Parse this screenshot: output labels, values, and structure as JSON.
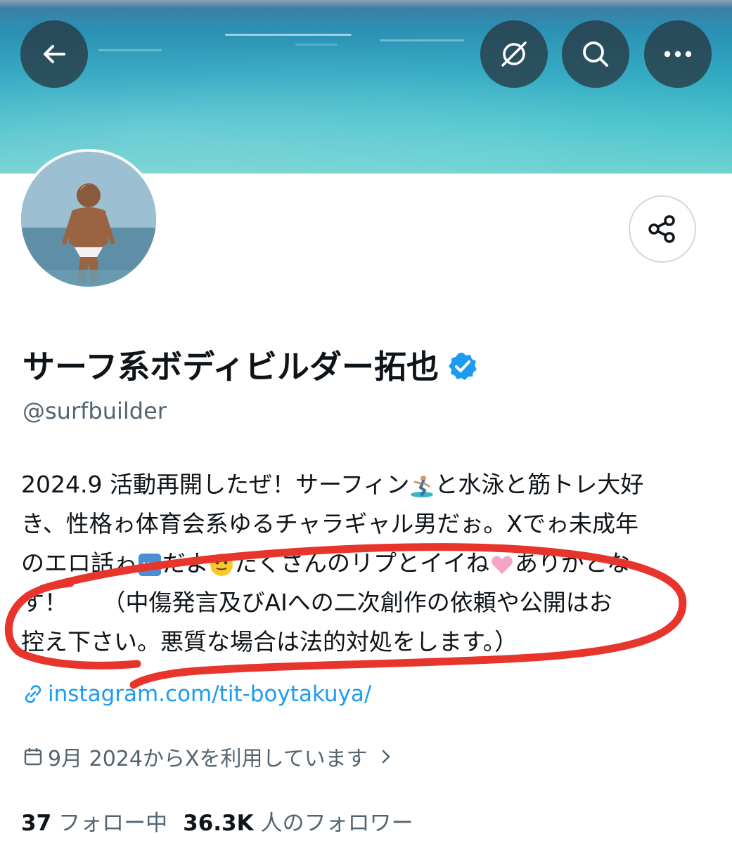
{
  "header": {
    "back_icon": "arrow-left-icon",
    "buttons": [
      {
        "icon": "no-notifications-icon"
      },
      {
        "icon": "search-icon"
      },
      {
        "icon": "more-horizontal-icon"
      }
    ]
  },
  "profile": {
    "display_name": "サーフ系ボディビルダー拓也",
    "verified": true,
    "verified_color": "#1d9bf0",
    "handle": "@surfbuilder",
    "bio_lines": [
      {
        "a": "2024.9 活動再開したぜ！サーフィン",
        "emoji": "surfer-emoji",
        "b": "と水泳と筋トレ大好"
      },
      {
        "a": "き、性格ゎ体育会系ゆるチャラギャル男だぉ。Xでゎ未成年",
        "emoji": "",
        "b": ""
      },
      {
        "a": "のエロ話ゎ",
        "emoji": "ng-button-emoji",
        "b": "だよ",
        "emoji2": "smiley-emoji",
        "c": "たくさんのリプとイイね",
        "emoji3": "pink-heart-emoji",
        "d": "ありがとな"
      },
      {
        "a": "す！　　（中傷発言及びAIへの二次創作の依頼や公開はお",
        "emoji": "",
        "b": ""
      },
      {
        "a": "控え下さい。悪質な場合は法的対処をします。）",
        "emoji": "",
        "b": ""
      }
    ],
    "link": "instagram.com/tit-boytakuya/",
    "joined": "9月 2024からXを利用しています",
    "following_count": "37",
    "following_label": "フォロー中",
    "followers_count": "36.3K",
    "followers_label": "人のフォロワー"
  },
  "colors": {
    "accent": "#1d9bf0",
    "secondary_text": "#536471",
    "annotation_red": "#e8352c"
  }
}
